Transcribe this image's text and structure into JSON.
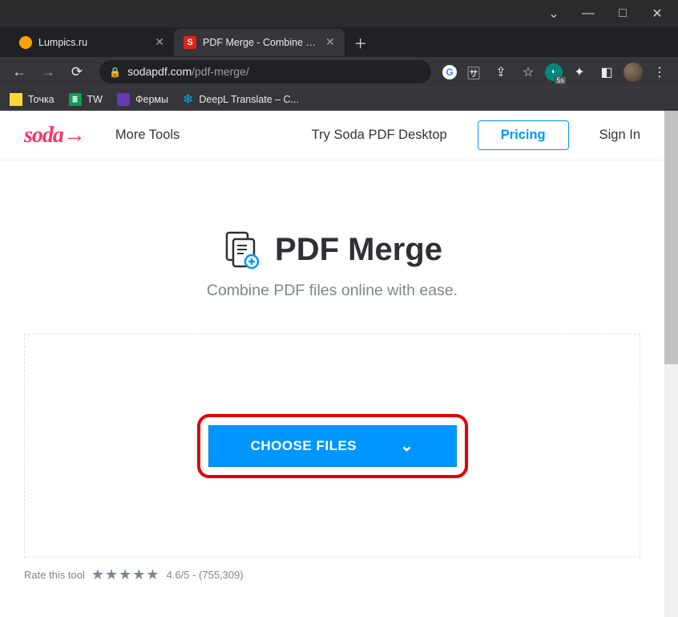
{
  "window": {
    "controls": [
      "⌄",
      "—",
      "□",
      "✕"
    ]
  },
  "tabs": [
    {
      "fav": "lum",
      "label": "Lumpics.ru"
    },
    {
      "fav": "s",
      "label": "PDF Merge - Combine PDF Files"
    }
  ],
  "newtab": "＋",
  "nav": {
    "back": "←",
    "forward": "→",
    "reload": "⟳"
  },
  "url": {
    "lock": "🔒",
    "host": "sodapdf.com",
    "path": "/pdf-merge/"
  },
  "toolbar": {
    "g": "G",
    "translate": "⠿",
    "share": "↗",
    "star": "☆",
    "puzzle": "✦",
    "square": "◧",
    "menu": "⋮"
  },
  "bookmarks": [
    {
      "kind": "y",
      "label": "Точка"
    },
    {
      "kind": "g",
      "glyph": "≣",
      "label": "TW"
    },
    {
      "kind": "p",
      "label": "Фермы"
    },
    {
      "kind": "d",
      "glyph": "❄",
      "label": "DeepL Translate – C..."
    }
  ],
  "site": {
    "logo": "soda→",
    "nav": {
      "more": "More Tools",
      "desktop": "Try Soda PDF Desktop",
      "pricing": "Pricing",
      "signin": "Sign In"
    },
    "title": "PDF Merge",
    "subtitle": "Combine PDF files online with ease.",
    "cta": "CHOOSE FILES",
    "caret": "⌄",
    "rate_label": "Rate this tool",
    "rate_score": "4.6/5 - (755,309)"
  }
}
